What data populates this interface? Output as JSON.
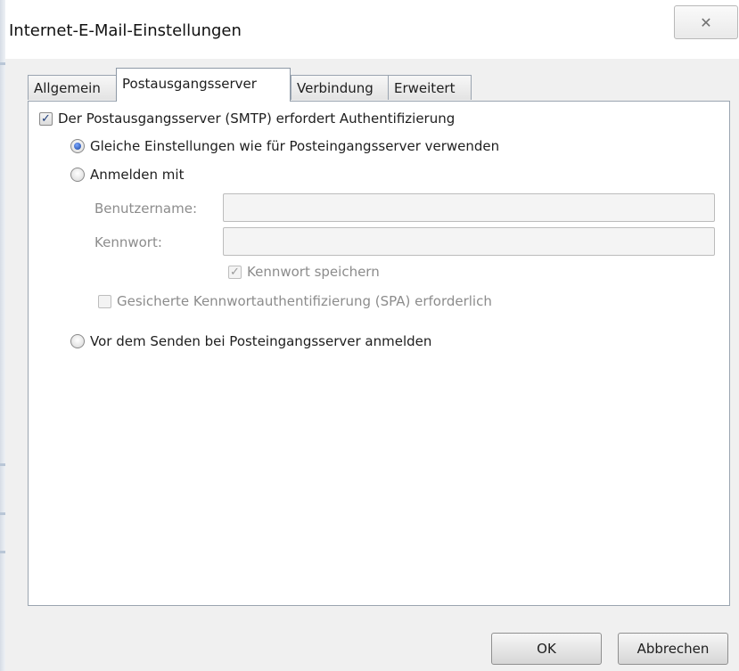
{
  "window": {
    "title": "Internet-E-Mail-Einstellungen",
    "close_glyph": "✕"
  },
  "tabs": [
    {
      "label": "Allgemein",
      "active": false
    },
    {
      "label": "Postausgangsserver",
      "active": true
    },
    {
      "label": "Verbindung",
      "active": false
    },
    {
      "label": "Erweitert",
      "active": false
    }
  ],
  "outgoing": {
    "smtp_auth_label": "Der Postausgangsserver (SMTP) erfordert Authentifizierung",
    "smtp_auth_checked": true,
    "same_settings_label": "Gleiche Einstellungen wie für Posteingangsserver verwenden",
    "same_settings_selected": true,
    "login_with_label": "Anmelden mit",
    "username_label": "Benutzername:",
    "username_value": "",
    "password_label": "Kennwort:",
    "password_value": "",
    "save_password_label": "Kennwort speichern",
    "save_password_checked": true,
    "spa_label": "Gesicherte Kennwortauthentifizierung (SPA) erforderlich",
    "spa_checked": false,
    "login_before_send_label": "Vor dem Senden bei Posteingangsserver anmelden",
    "login_before_send_selected": false
  },
  "buttons": {
    "ok": "OK",
    "cancel": "Abbrechen"
  },
  "colors": {
    "accent": "#16409a",
    "disabled_text": "#8c8c8c"
  }
}
